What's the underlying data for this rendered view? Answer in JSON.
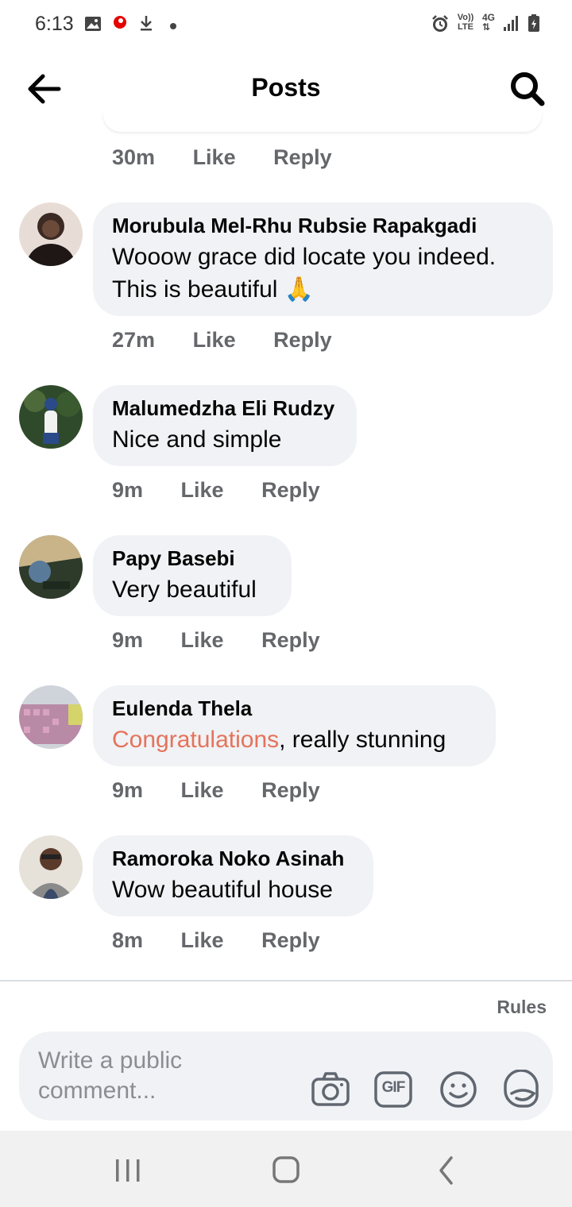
{
  "status_bar": {
    "time": "6:13",
    "left_icons": [
      "image-icon",
      "vodafone-icon",
      "download-icon",
      "dot-icon"
    ],
    "right_icons": [
      "alarm-icon",
      "volte-icon",
      "4g-icon",
      "signal-icon",
      "battery-icon"
    ],
    "volte_label": "Vo)) LTE",
    "network_label": "4G"
  },
  "app_bar": {
    "title": "Posts",
    "back_icon": "back-arrow-icon",
    "search_icon": "search-icon"
  },
  "previous_comment": {
    "time": "30m",
    "like_label": "Like",
    "reply_label": "Reply"
  },
  "comments": [
    {
      "author": "Morubula Mel-Rhu Rubsie Rapakgadi",
      "text_line1": "Wooow grace did locate you indeed.",
      "text_line2": "This is beautiful",
      "emoji": "🙏",
      "time": "27m",
      "like_label": "Like",
      "reply_label": "Reply",
      "avatar_color": "#3b2a24"
    },
    {
      "author": "Malumedzha Eli Rudzy",
      "text": "Nice and simple",
      "time": "9m",
      "like_label": "Like",
      "reply_label": "Reply",
      "avatar_color": "#2f4a2a"
    },
    {
      "author": "Papy Basebi",
      "text": "Very beautiful",
      "time": "9m",
      "like_label": "Like",
      "reply_label": "Reply",
      "avatar_color": "#3e4a3a"
    },
    {
      "author": "Eulenda Thela",
      "text_highlight": "Congratulations",
      "text_rest": ", really stunning",
      "time": "9m",
      "like_label": "Like",
      "reply_label": "Reply",
      "avatar_color": "#b88aa6"
    },
    {
      "author": "Ramoroka Noko Asinah",
      "text": "Wow beautiful house",
      "time": "8m",
      "like_label": "Like",
      "reply_label": "Reply",
      "avatar_color": "#c9c3b8"
    }
  ],
  "composer": {
    "rules_label": "Rules",
    "placeholder": "Write a public comment...",
    "icons": [
      "camera-icon",
      "gif-icon",
      "emoji-icon",
      "sticker-icon"
    ],
    "gif_label": "GIF"
  },
  "nav_bar": {
    "icons": [
      "recent-apps-icon",
      "home-icon",
      "back-icon"
    ]
  },
  "colors": {
    "bubble": "#f0f2f5",
    "secondary_text": "#65676b",
    "highlight": "#e5735b"
  }
}
